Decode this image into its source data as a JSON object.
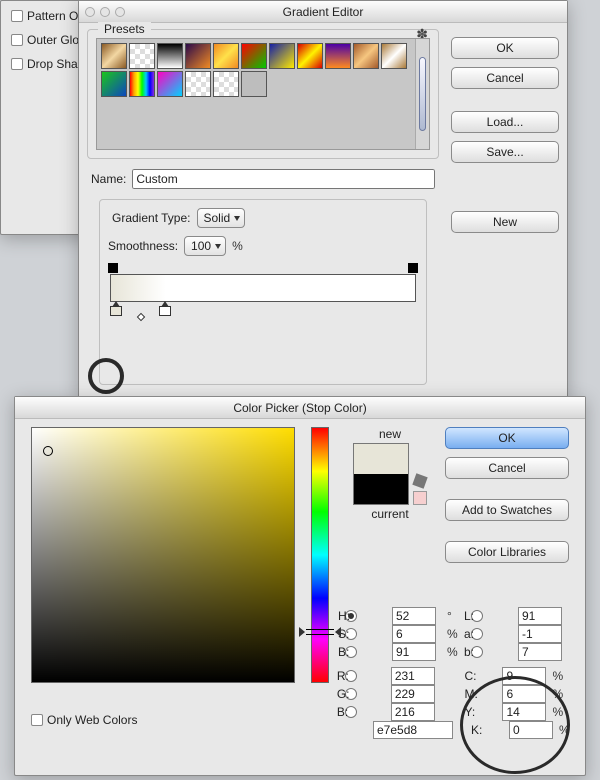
{
  "layers": {
    "items": [
      "Pattern Overlay",
      "Outer Glow",
      "Drop Shadow"
    ]
  },
  "gradient_editor": {
    "title": "Gradient Editor",
    "presets_label": "Presets",
    "name_label": "Name:",
    "name_value": "Custom",
    "type_label": "Gradient Type:",
    "type_value": "Solid",
    "smooth_label": "Smoothness:",
    "smooth_value": "100",
    "percent": "%",
    "buttons": {
      "ok": "OK",
      "cancel": "Cancel",
      "load": "Load...",
      "save": "Save...",
      "newbtn": "New"
    }
  },
  "swatches": [
    "linear-gradient(135deg,#8b5a24,#f3d7a3,#8b5a24)",
    "repeating-conic-gradient(#ddd 0 25%,#fff 0 50%) 0 0/10px 10px",
    "linear-gradient(180deg,#000,#fff)",
    "linear-gradient(135deg,#2c0a4a,#f08a23)",
    "linear-gradient(135deg,#f08a23,#ffe14a,#f08a23)",
    "linear-gradient(135deg,#ff0000,#00c800)",
    "linear-gradient(135deg,#1520a6,#ffea00)",
    "linear-gradient(135deg,#d90000,#fff200,#d90000)",
    "linear-gradient(180deg,#4c00a6,#ff8b1f)",
    "linear-gradient(135deg,#a45a2a,#f6c680,#a45a2a)",
    "linear-gradient(135deg,#aa7a39,#fff,#aa7a39)",
    "linear-gradient(135deg,#1bc51b,#0d47be)",
    "linear-gradient(90deg,#ff0000,#ffa500,#ffff00,#00ff00,#00c8ff,#0000ff,#8a2be2)",
    "linear-gradient(135deg,#ff00c3,#00d2ff)",
    "repeating-conic-gradient(#ddd 0 25%,#fff 0 50%) 0 0/10px 10px",
    "repeating-conic-gradient(#ddd 0 25%,#fff 0 50%) 0 0/10px 10px",
    "#bdbdbd"
  ],
  "color_picker": {
    "title": "Color Picker (Stop Color)",
    "new_label": "new",
    "current_label": "current",
    "buttons": {
      "ok": "OK",
      "cancel": "Cancel",
      "add": "Add to Swatches",
      "lib": "Color Libraries"
    },
    "only_web": "Only Web Colors",
    "hex_label": "#",
    "hex": "e7e5d8",
    "H": "52",
    "S": "6",
    "Bhsb": "91",
    "R": "231",
    "G": "229",
    "Brgb": "216",
    "L": "91",
    "a": "-1",
    "blab": "7",
    "C": "9",
    "M": "6",
    "Y": "14",
    "K": "0",
    "deg": "°",
    "pct": "%",
    "labels": {
      "H": "H:",
      "S": "S:",
      "Bhsb": "B:",
      "R": "R:",
      "G": "G:",
      "Brgb": "B:",
      "L": "L:",
      "a": "a:",
      "blab": "b:",
      "C": "C:",
      "M": "M:",
      "Y": "Y:",
      "K": "K:"
    }
  }
}
